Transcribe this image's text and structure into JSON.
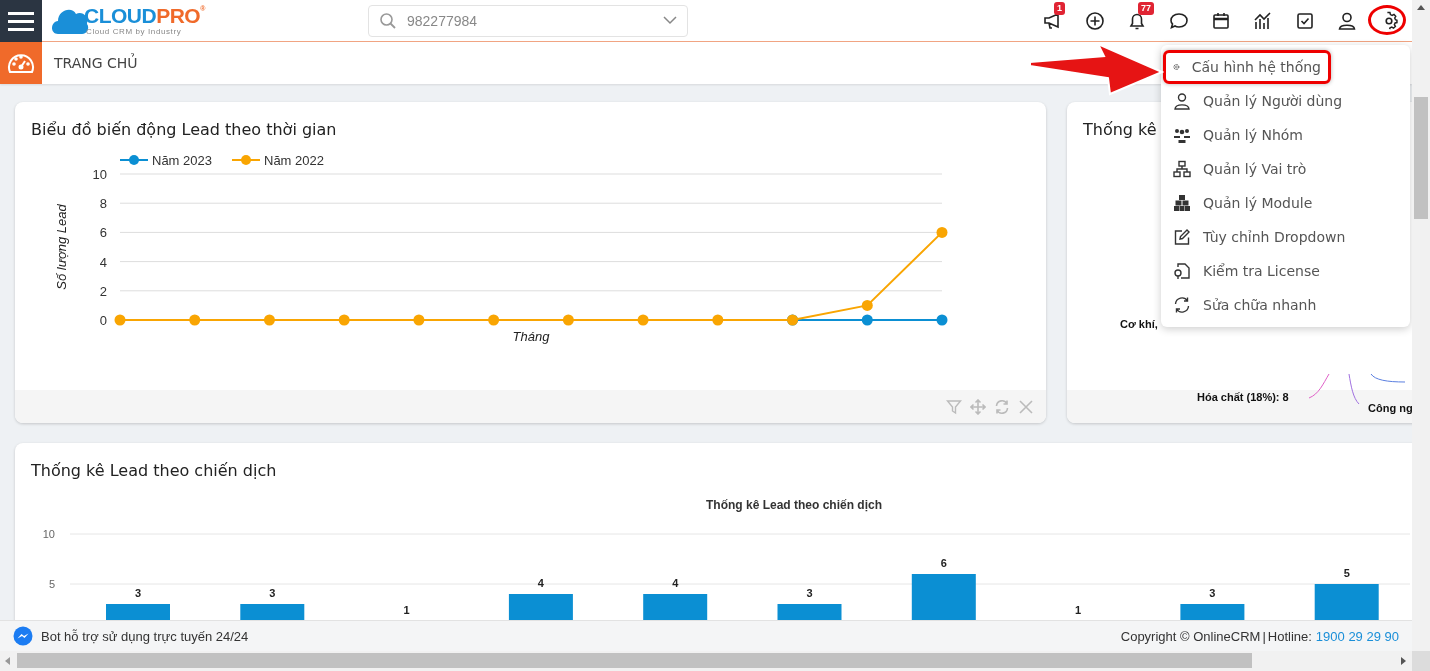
{
  "header": {
    "logo": {
      "word_1": "CLOUD",
      "word_2": "PRO",
      "mark": "®",
      "tagline": "Cloud CRM by Industry"
    },
    "search": {
      "value": "982277984"
    },
    "icons": [
      {
        "kind": "megaphone",
        "badge": "1"
      },
      {
        "kind": "plus"
      },
      {
        "kind": "bell",
        "badge": "77"
      },
      {
        "kind": "chat"
      },
      {
        "kind": "calendar"
      },
      {
        "kind": "chart"
      },
      {
        "kind": "task"
      },
      {
        "kind": "user"
      },
      {
        "kind": "gear"
      }
    ]
  },
  "page_title": "TRANG CHỦ",
  "cards": [
    {
      "title": "Biểu đồ biến động Lead theo thời gian",
      "chart_data": {
        "type": "line",
        "xlabel": "Tháng",
        "ylabel": "Số lượng Lead",
        "ylim": [
          0,
          10
        ],
        "yticks": [
          0,
          2,
          4,
          6,
          8,
          10
        ],
        "grid": true,
        "legend": "top",
        "series": [
          {
            "name": "Năm 2023",
            "color": "#0b8fd3",
            "marker": "circle",
            "values": [
              null,
              null,
              null,
              null,
              null,
              null,
              null,
              null,
              null,
              0,
              0,
              0
            ]
          },
          {
            "name": "Năm 2022",
            "color": "#f9a502",
            "marker": "circle",
            "values": [
              0,
              0,
              0,
              0,
              0,
              0,
              0,
              0,
              0,
              0,
              1,
              6
            ]
          }
        ]
      }
    },
    {
      "title": "Thống kê",
      "labels": [
        "Cơ khí,",
        "Hóa chất (18%): 8",
        "Công ng"
      ]
    },
    {
      "title": "Thống kê Lead theo chiến dịch",
      "chart_data": {
        "type": "bar",
        "title": "Thống kê Lead theo chiến dịch",
        "ylim": [
          0,
          10
        ],
        "yticks": [
          5,
          10
        ],
        "grid": true,
        "value_labels": [
          "3",
          "3",
          "1",
          "4",
          "4",
          "3",
          "6",
          "1",
          "3",
          "5"
        ],
        "series": [
          {
            "color": "#0b8fd3",
            "values": [
              3,
              3,
              null,
              4,
              4,
              3,
              6,
              null,
              3,
              5
            ]
          }
        ]
      }
    }
  ],
  "menu": {
    "items": [
      {
        "kind": "gear",
        "label": "Cấu hình hệ thống",
        "highlighted": true
      },
      {
        "kind": "user",
        "label": "Quản lý Người dùng",
        "highlighted": false
      },
      {
        "kind": "users",
        "label": "Quản lý Nhóm",
        "highlighted": false
      },
      {
        "kind": "sitemap",
        "label": "Quản lý Vai trò",
        "highlighted": false
      },
      {
        "kind": "cubes",
        "label": "Quản lý Module",
        "highlighted": false
      },
      {
        "kind": "edit",
        "label": "Tùy chỉnh Dropdown",
        "highlighted": false
      },
      {
        "kind": "license",
        "label": "Kiểm tra License",
        "highlighted": false
      },
      {
        "kind": "refresh",
        "label": "Sửa chữa nhanh",
        "highlighted": false
      }
    ]
  },
  "annotations": {
    "settings_ring": true,
    "arrow": true
  },
  "footer": {
    "bot": "Bot hỗ trợ sử dụng trực tuyến 24/24",
    "copyright": "Copyright © OnlineCRM",
    "separator": "|",
    "hotline_label": "Hotline:",
    "hotline": "1900 29 29 90"
  }
}
